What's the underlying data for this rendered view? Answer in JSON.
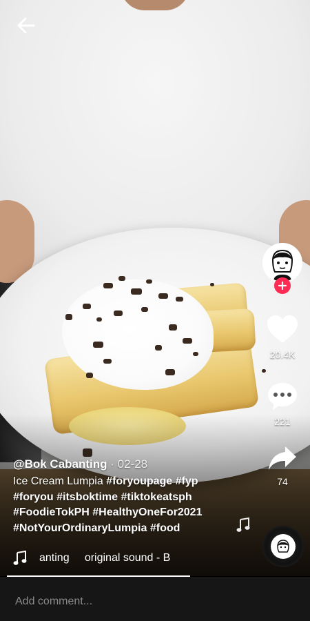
{
  "post": {
    "author": "@Bok Cabanting",
    "separator": " · ",
    "date": "02-28",
    "description_prefix": "Ice Cream Lumpia ",
    "hashtags": [
      "#foryoupage",
      "#fyp",
      "#foryou",
      "#itsboktime",
      "#tiktokeatsph",
      "#FoodieTokPH",
      "#HealthyOneFor2021",
      "#NotYourOrdinaryLumpia",
      "#food"
    ]
  },
  "actions": {
    "likes": "20.4K",
    "comments": "221",
    "shares": "74"
  },
  "music": {
    "scroll_text": "anting     original sound - B"
  },
  "comment_input": {
    "placeholder": "Add comment..."
  },
  "icons": {
    "back": "back-arrow-icon",
    "like": "heart-icon",
    "comment": "comment-bubble-icon",
    "share": "share-arrow-icon",
    "music": "music-note-icon",
    "follow": "plus-icon"
  },
  "colors": {
    "follow": "#fe2c55",
    "comment_bar": "#161616",
    "placeholder": "#8a8a8a"
  },
  "progress": 0.59
}
